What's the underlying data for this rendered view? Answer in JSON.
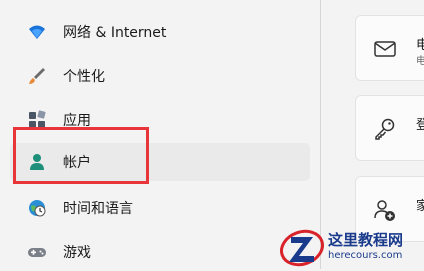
{
  "sidebar": {
    "items": [
      {
        "label": "网络 & Internet",
        "icon": "wifi-icon"
      },
      {
        "label": "个性化",
        "icon": "paintbrush-icon"
      },
      {
        "label": "应用",
        "icon": "apps-icon"
      },
      {
        "label": "帐户",
        "icon": "account-icon",
        "selected": true
      },
      {
        "label": "时间和语言",
        "icon": "globe-clock-icon"
      },
      {
        "label": "游戏",
        "icon": "gamepad-icon"
      }
    ]
  },
  "cards": [
    {
      "icon": "mail-icon",
      "title": "电",
      "sub": "电"
    },
    {
      "icon": "key-icon",
      "title": "登"
    },
    {
      "icon": "add-family-icon",
      "title": "家"
    }
  ],
  "watermark": {
    "title": "这里教程网",
    "url": "herecours.com"
  },
  "colors": {
    "accent": "#0067c0",
    "highlight_border": "#e8353a",
    "watermark_blue": "#1a3b8c"
  }
}
